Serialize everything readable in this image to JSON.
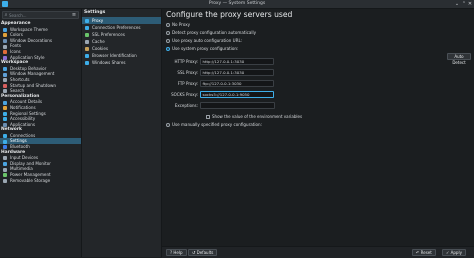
{
  "window": {
    "title": "Proxy — System Settings",
    "minimize": "⌄",
    "maximize": "⌃",
    "close": "✕"
  },
  "sidebar": {
    "search_placeholder": "Search...",
    "menu_icon": "≡",
    "sections": [
      {
        "title": "Appearance",
        "items": [
          {
            "label": "Workspace Theme",
            "color": "#4aa3df"
          },
          {
            "label": "Colors",
            "color": "#e0a13a"
          },
          {
            "label": "Window Decorations",
            "color": "#6b8fb3"
          },
          {
            "label": "Fonts",
            "color": "#9aa6b2"
          },
          {
            "label": "Icons",
            "color": "#e06c3a"
          },
          {
            "label": "Application Style",
            "color": "#8d6fd6"
          }
        ]
      },
      {
        "title": "Workspace",
        "items": [
          {
            "label": "Desktop Behavior",
            "color": "#4aa3df"
          },
          {
            "label": "Window Management",
            "color": "#5fa0d6"
          },
          {
            "label": "Shortcuts",
            "color": "#9aa6b2"
          },
          {
            "label": "Startup and Shutdown",
            "color": "#d65f5f"
          },
          {
            "label": "Search",
            "color": "#9aa6b2"
          }
        ]
      },
      {
        "title": "Personalization",
        "items": [
          {
            "label": "Account Details",
            "color": "#4aa3df"
          },
          {
            "label": "Notifications",
            "color": "#e0a13a"
          },
          {
            "label": "Regional Settings",
            "color": "#3daee9"
          },
          {
            "label": "Accessibility",
            "color": "#3daee9"
          },
          {
            "label": "Applications",
            "color": "#6b8fb3"
          }
        ]
      },
      {
        "title": "Network",
        "items": [
          {
            "label": "Connections",
            "color": "#3daee9"
          },
          {
            "label": "Settings",
            "color": "#3daee9",
            "selected": true
          },
          {
            "label": "Bluetooth",
            "color": "#3d7de9"
          }
        ]
      },
      {
        "title": "Hardware",
        "items": [
          {
            "label": "Input Devices",
            "color": "#9aa6b2"
          },
          {
            "label": "Display and Monitor",
            "color": "#4aa3df"
          },
          {
            "label": "Multimedia",
            "color": "#9aa6b2"
          },
          {
            "label": "Power Management",
            "color": "#6ac46a"
          },
          {
            "label": "Removable Storage",
            "color": "#9aa6b2"
          }
        ]
      }
    ]
  },
  "network_settings": {
    "header": "Settings",
    "items": [
      {
        "label": "Proxy",
        "color": "#3daee9",
        "selected": true
      },
      {
        "label": "Connection Preferences",
        "color": "#3daee9"
      },
      {
        "label": "SSL Preferences",
        "color": "#6ac46a"
      },
      {
        "label": "Cache",
        "color": "#9aa6b2"
      },
      {
        "label": "Cookies",
        "color": "#c7a15a"
      },
      {
        "label": "Browser Identification",
        "color": "#3daee9"
      },
      {
        "label": "Windows Shares",
        "color": "#3daee9"
      }
    ]
  },
  "proxy": {
    "heading": "Configure the proxy servers used",
    "options": {
      "no_proxy": "No Proxy",
      "auto_detect": "Detect proxy configuration automatically",
      "auto_url": "Use proxy auto configuration URL:",
      "system": "Use system proxy configuration:",
      "manual": "Use manually specified proxy configuration:"
    },
    "selected_option": "system",
    "auto_detect_button": "Auto Detect",
    "fields": {
      "http_label": "HTTP Proxy:",
      "http_value": "http://127.0.0.1:3030",
      "ssl_label": "SSL Proxy:",
      "ssl_value": "http://127.0.0.1:3030",
      "ftp_label": "FTP Proxy:",
      "ftp_value": "ftp://127.0.0.1:3030",
      "socks_label": "SOCKS Proxy:",
      "socks_value": "socks5://127.0.0.1:9050",
      "exceptions_label": "Exceptions:",
      "exceptions_value": ""
    },
    "show_env_values": "Show the value of the environment variables"
  },
  "footer": {
    "help": "Help",
    "defaults": "Defaults",
    "reset": "Reset",
    "apply": "Apply"
  }
}
